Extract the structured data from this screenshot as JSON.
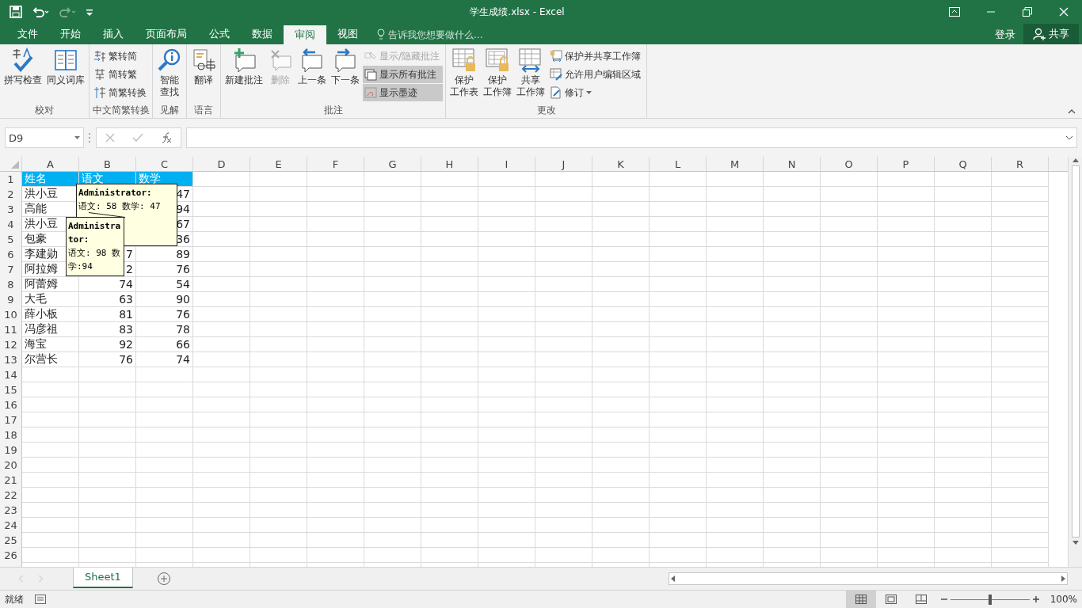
{
  "quick_access": [
    {
      "kind": "save",
      "disabled": false
    },
    {
      "kind": "undo",
      "disabled": false
    },
    {
      "kind": "redo",
      "disabled": true
    },
    {
      "kind": "customize",
      "disabled": false
    }
  ],
  "window": {
    "title": "学生成绩.xlsx - Excel"
  },
  "menu_tabs": [
    {
      "label": "文件",
      "selected": false
    },
    {
      "label": "开始",
      "selected": false
    },
    {
      "label": "插入",
      "selected": false
    },
    {
      "label": "页面布局",
      "selected": false
    },
    {
      "label": "公式",
      "selected": false
    },
    {
      "label": "数据",
      "selected": false
    },
    {
      "label": "审阅",
      "selected": true
    },
    {
      "label": "视图",
      "selected": false
    }
  ],
  "tell_me": {
    "placeholder": "告诉我您想要做什么..."
  },
  "account": {
    "sign_in": "登录",
    "share": "共享"
  },
  "ribbon_groups": [
    {
      "label": "校对",
      "items": [
        {
          "kind": "large",
          "lines": [
            "拼写检查"
          ],
          "disabled": false
        },
        {
          "kind": "large",
          "lines": [
            "同义词库"
          ],
          "disabled": false
        }
      ]
    },
    {
      "label": "中文简繁转换",
      "items": [
        {
          "kind": "small",
          "label": "繁转简",
          "disabled": false
        },
        {
          "kind": "small",
          "label": "简转繁",
          "disabled": false
        },
        {
          "kind": "small",
          "label": "简繁转换",
          "disabled": false
        }
      ]
    },
    {
      "label": "见解",
      "items": [
        {
          "kind": "large",
          "lines": [
            "智能",
            "查找"
          ],
          "disabled": false
        }
      ]
    },
    {
      "label": "语言",
      "items": [
        {
          "kind": "large",
          "lines": [
            "翻译"
          ],
          "disabled": false
        }
      ]
    },
    {
      "label": "批注",
      "items": [
        {
          "kind": "large",
          "lines": [
            "新建批注"
          ],
          "disabled": false
        },
        {
          "kind": "large",
          "lines": [
            "删除"
          ],
          "disabled": true
        },
        {
          "kind": "large",
          "lines": [
            "上一条"
          ],
          "disabled": false
        },
        {
          "kind": "large",
          "lines": [
            "下一条"
          ],
          "disabled": false
        },
        {
          "kind": "small",
          "label": "显示/隐藏批注",
          "disabled": true,
          "selected": false
        },
        {
          "kind": "small",
          "label": "显示所有批注",
          "disabled": false,
          "selected": true
        },
        {
          "kind": "small",
          "label": "显示墨迹",
          "disabled": false,
          "selected": true
        }
      ]
    },
    {
      "label": "更改",
      "items": [
        {
          "kind": "large",
          "lines": [
            "保护",
            "工作表"
          ],
          "disabled": false
        },
        {
          "kind": "large",
          "lines": [
            "保护",
            "工作簿"
          ],
          "disabled": false
        },
        {
          "kind": "large",
          "lines": [
            "共享",
            "工作簿"
          ],
          "disabled": false
        },
        {
          "kind": "small",
          "label": "保护并共享工作簿",
          "disabled": false
        },
        {
          "kind": "small",
          "label": "允许用户编辑区域",
          "disabled": false
        },
        {
          "kind": "small",
          "label": "修订",
          "disabled": false,
          "dropdown": true
        }
      ]
    }
  ],
  "formula_bar": {
    "name_box": "D9"
  },
  "columns": [
    "A",
    "B",
    "C",
    "D",
    "E",
    "F",
    "G",
    "H",
    "I",
    "J",
    "K",
    "L",
    "M",
    "N",
    "O",
    "P",
    "Q",
    "R"
  ],
  "row_numbers": [
    "1",
    "2",
    "3",
    "4",
    "5",
    "6",
    "7",
    "8",
    "9",
    "10",
    "11",
    "12",
    "13",
    "14",
    "15",
    "16",
    "17",
    "18",
    "19",
    "20",
    "21",
    "22",
    "23",
    "24",
    "25",
    "26"
  ],
  "header_row": [
    "姓名",
    "语文",
    "数学"
  ],
  "rows": [
    [
      "洪小豆",
      null,
      "47"
    ],
    [
      "高能",
      null,
      "94"
    ],
    [
      "洪小豆",
      null,
      "67"
    ],
    [
      "包豪",
      null,
      "36"
    ],
    [
      "李建勋",
      "7",
      "89"
    ],
    [
      "阿拉姆",
      "2",
      "76"
    ],
    [
      "阿蕾姆",
      "74",
      "54"
    ],
    [
      "大毛",
      "63",
      "90"
    ],
    [
      "薛小板",
      "81",
      "76"
    ],
    [
      "冯彦祖",
      "83",
      "78"
    ],
    [
      "海宝",
      "92",
      "66"
    ],
    [
      "尔营长",
      "76",
      "74"
    ]
  ],
  "comments": [
    {
      "author": "Administrator:",
      "text": "语文: 58 数学: 47"
    },
    {
      "author": "Administrator:",
      "text": "语文: 98 数学:94"
    }
  ],
  "sheet_tabs": [
    {
      "label": "Sheet1",
      "selected": true
    }
  ],
  "status_bar": {
    "status": "就绪",
    "zoom": "100%",
    "zoom_slider": {
      "level": 0.5
    },
    "views": [
      {
        "kind": "normal",
        "selected": true
      },
      {
        "kind": "page_layout",
        "selected": false
      },
      {
        "kind": "page_break",
        "selected": false
      }
    ]
  }
}
